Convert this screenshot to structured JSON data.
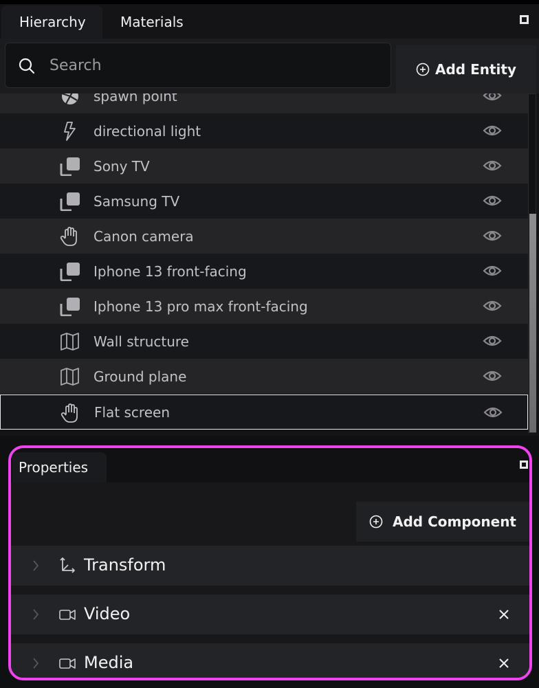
{
  "hierarchy": {
    "tabs": [
      {
        "label": "Hierarchy",
        "active": true
      },
      {
        "label": "Materials",
        "active": false
      }
    ],
    "search": {
      "placeholder": "Search",
      "value": ""
    },
    "add_entity_label": "Add Entity",
    "scroll_position_percent": 100,
    "entities": [
      {
        "label": "spawn point",
        "icon": "aperture-icon",
        "visible": true
      },
      {
        "label": "directional light",
        "icon": "lightning-icon",
        "visible": true
      },
      {
        "label": "Sony TV",
        "icon": "copy-icon",
        "visible": true
      },
      {
        "label": "Samsung TV",
        "icon": "copy-icon",
        "visible": true
      },
      {
        "label": "Canon camera",
        "icon": "hand-icon",
        "visible": true
      },
      {
        "label": "Iphone 13 front-facing",
        "icon": "copy-icon",
        "visible": true
      },
      {
        "label": "Iphone 13 pro max front-facing",
        "icon": "copy-icon",
        "visible": true
      },
      {
        "label": "Wall structure",
        "icon": "map-icon",
        "visible": true
      },
      {
        "label": "Ground plane",
        "icon": "map-icon",
        "visible": true
      },
      {
        "label": "Flat screen",
        "icon": "hand-icon",
        "visible": true,
        "selected": true
      }
    ]
  },
  "properties": {
    "tab_label": "Properties",
    "add_component_label": "Add Component",
    "highlight_color": "#ee44ee",
    "components": [
      {
        "label": "Transform",
        "icon": "axes-icon",
        "removable": false
      },
      {
        "label": "Video",
        "icon": "video-camera-icon",
        "removable": true
      },
      {
        "label": "Media",
        "icon": "video-camera-icon",
        "removable": true
      }
    ]
  }
}
